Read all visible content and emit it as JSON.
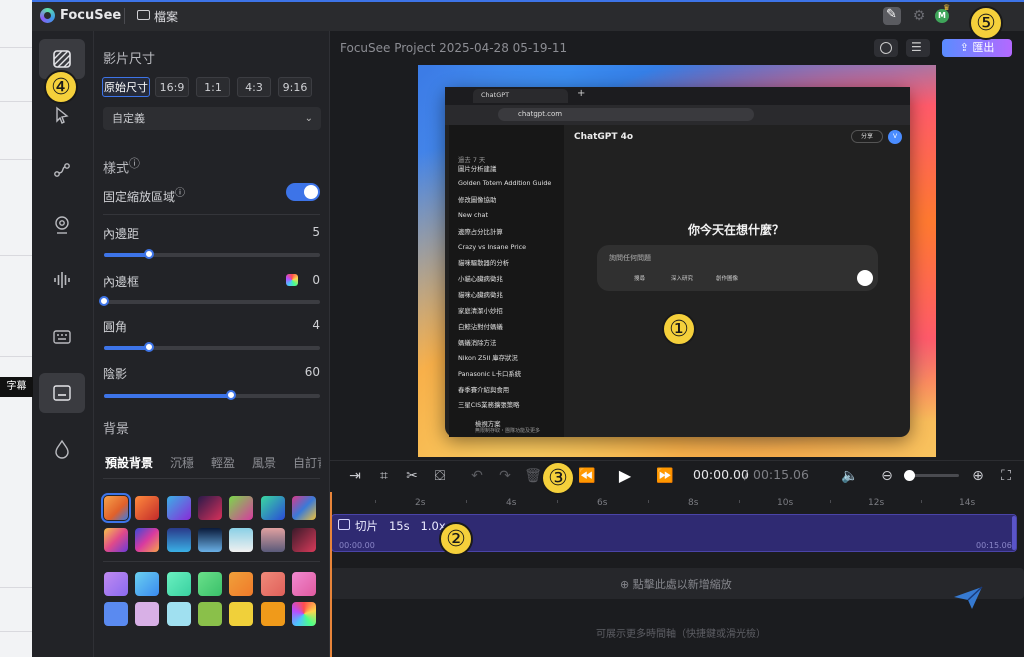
{
  "app": {
    "name": "FocuSee",
    "menu_file": "檔案",
    "avatar_initial": "M"
  },
  "project_title": "FocuSee Project 2025-04-28 05-19-11",
  "export_label": "匯出",
  "tooltip_label": "字幕",
  "panel": {
    "video_size_heading": "影片尺寸",
    "ratios": [
      "原始尺寸",
      "16:9",
      "1:1",
      "4:3",
      "9:16"
    ],
    "preset_value": "自定義",
    "style_heading": "樣式",
    "fixed_zoom_label": "固定縮放區域",
    "fixed_zoom_on": true,
    "padding": {
      "label": "內邊距",
      "value": "5",
      "fraction": 0.21
    },
    "border": {
      "label": "內邊框",
      "value": "0",
      "fraction": 0.0
    },
    "corner": {
      "label": "圓角",
      "value": "4",
      "fraction": 0.21
    },
    "shadow": {
      "label": "陰影",
      "value": "60",
      "fraction": 0.59
    },
    "background_heading": "背景",
    "bg_tabs": [
      "預設背景",
      "沉穩",
      "輕盈",
      "風景",
      "自訂背"
    ]
  },
  "preview": {
    "url": "chatgpt.com",
    "tab_title": "ChatGPT",
    "model": "ChatGPT 4o",
    "question": "你今天在想什麼？",
    "input_placeholder": "詢問任何問題",
    "chips": [
      "搜尋",
      "深入研究",
      "創作圖像"
    ],
    "share_label": "分享",
    "avatar_initial": "V",
    "sidebar_heading": "過去 7 天",
    "sidebar_items": [
      "圖片分析建議",
      "Golden Totem Addition Guide",
      "修改圖像協助",
      "New chat",
      "邊際占分比計算",
      "Crazy vs Insane Price",
      "貓咪驅散器的分析",
      "小貓心臟病徵兆",
      "貓咪心臟病徵兆",
      "家庭清潔小妙招",
      "白鯨沾對付螞蟻",
      "螞蟻消除方法",
      "Nikon Z5II 庫存狀況",
      "Panasonic L卡口系統",
      "春季賽介紹與食用",
      "三星CIS業務擴張策略"
    ],
    "upgrade_title": "檢視方案",
    "upgrade_sub": "無限制存取・團隊功能及更多"
  },
  "transport": {
    "time_current": "00:00.00",
    "time_separator": "/",
    "time_total": "00:15.06"
  },
  "timeline": {
    "ticks": [
      "2s",
      "4s",
      "6s",
      "8s",
      "10s",
      "12s",
      "14s"
    ],
    "clip_label": "切片   15s   1.0x",
    "clip_start": "00:00.00",
    "clip_end": "00:15.06",
    "zoom_lane_text": "點擊此處以新增縮放",
    "hint": "可展示更多時間軸（快捷鍵或滑光檢）"
  },
  "markers": [
    "①",
    "②",
    "③",
    "④",
    "⑤"
  ],
  "colors": {
    "accent": "#3d74e8",
    "clip": "#2f2a72",
    "marker": "#f5d03b"
  }
}
